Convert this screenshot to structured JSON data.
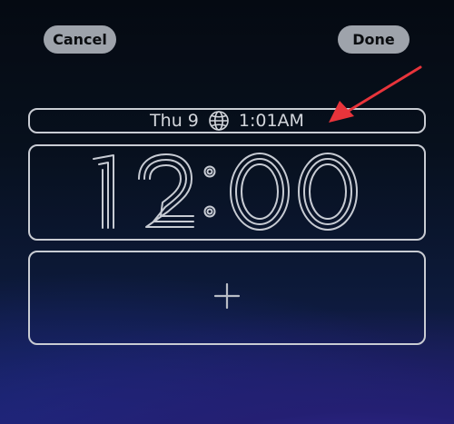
{
  "toolbar": {
    "cancel_label": "Cancel",
    "done_label": "Done"
  },
  "lock_screen": {
    "date_widget": {
      "day": "Thu 9",
      "icon": "globe-icon",
      "world_time": "1:01AM"
    },
    "clock": {
      "time": "12:00"
    },
    "widgets_area": {
      "icon": "plus-icon"
    }
  },
  "annotation": {
    "icon": "arrow-icon",
    "color": "#e8343b"
  },
  "colors": {
    "button_bg": "#9ea3ab",
    "outline": "#c9ccd3",
    "accent_arrow": "#e8343b"
  }
}
